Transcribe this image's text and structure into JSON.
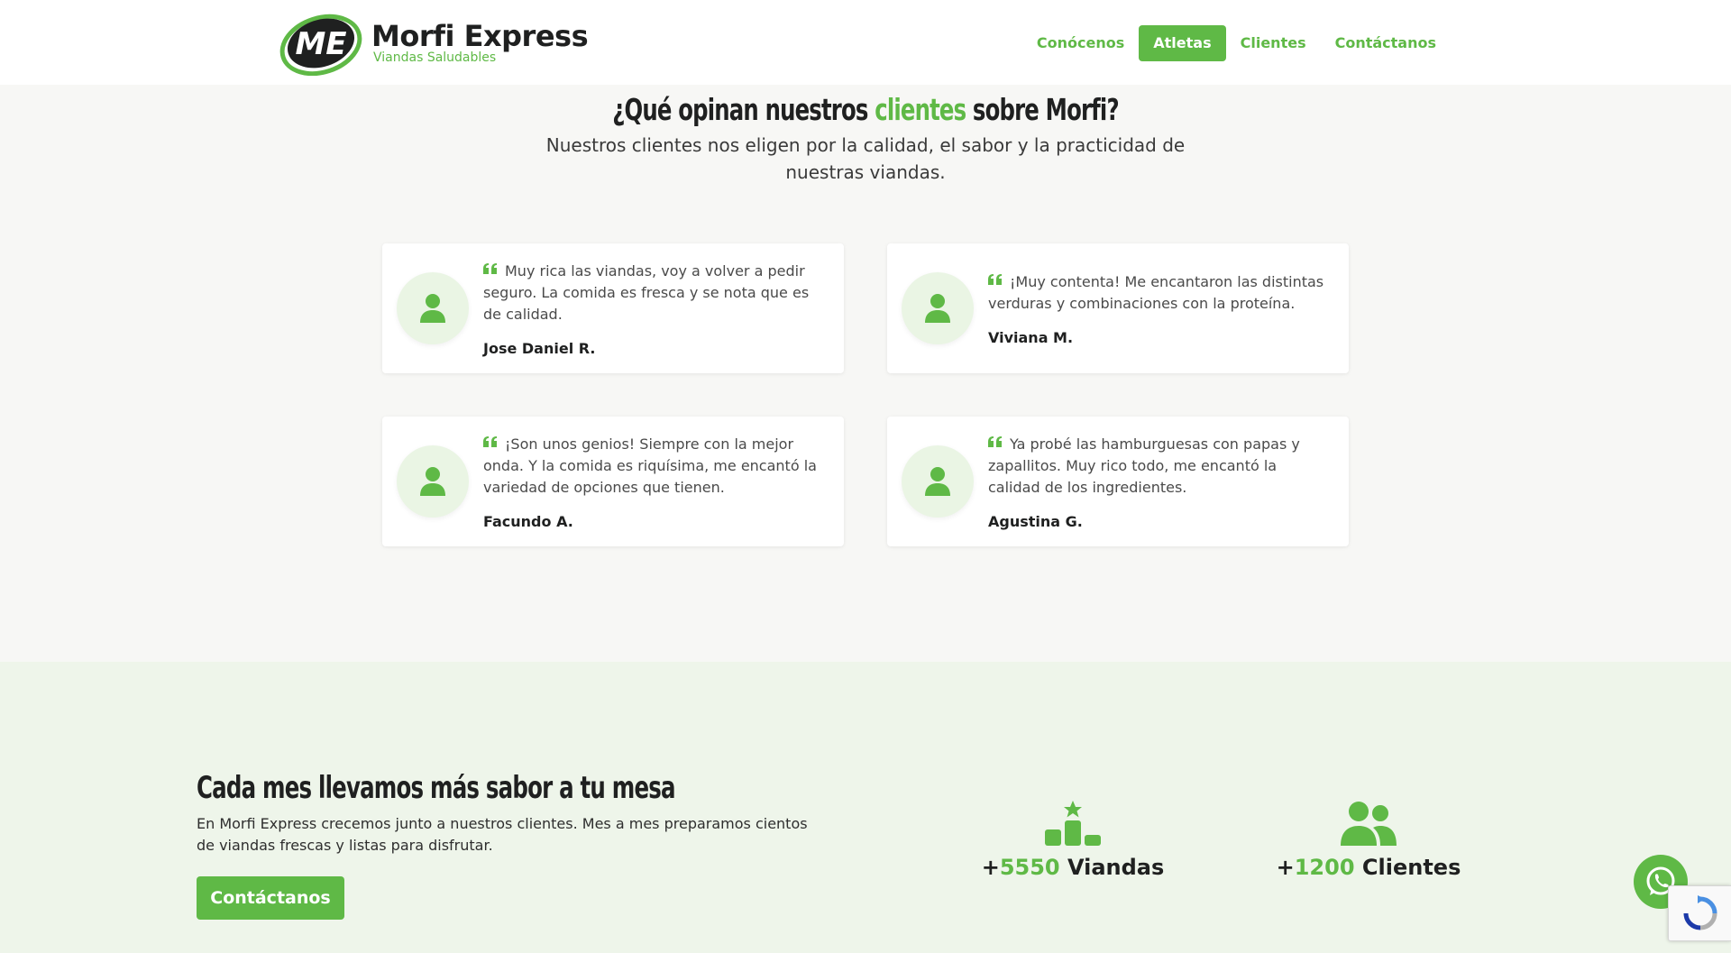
{
  "brand": {
    "name": "Morfi Express",
    "tagline": "Viandas Saludables",
    "mark": "ME"
  },
  "nav": {
    "items": [
      {
        "label": "Conócenos"
      },
      {
        "label": "Atletas"
      },
      {
        "label": "Clientes"
      },
      {
        "label": "Contáctanos"
      }
    ],
    "active": "Atletas"
  },
  "testimonials": {
    "title_before": "¿Qué opinan nuestros ",
    "title_highlight": "clientes",
    "title_after": " sobre Morfi?",
    "subtitle": "Nuestros clientes nos eligen por la calidad, el sabor y la practicidad de nuestras viandas.",
    "items": [
      {
        "quote": "Muy rica las viandas, voy a volver a pedir seguro. La comida es fresca y se nota que es de calidad.",
        "author": "Jose Daniel R."
      },
      {
        "quote": "¡Muy contenta! Me encantaron las distintas verduras y combinaciones con la proteína.",
        "author": "Viviana M."
      },
      {
        "quote": "¡Son unos genios! Siempre con la mejor onda. Y la comida es riquísima, me encantó la variedad de opciones que tienen.",
        "author": "Facundo A."
      },
      {
        "quote": "Ya probé las hamburguesas con papas y zapallitos. Muy rico todo, me encantó la calidad de los ingredientes.",
        "author": "Agustina G."
      }
    ]
  },
  "stats": {
    "title": "Cada mes llevamos más sabor a tu mesa",
    "text": "En Morfi Express crecemos junto a nuestros clientes. Mes a mes preparamos cientos de viandas frescas y listas para disfrutar.",
    "button_label": "Contáctanos",
    "items": [
      {
        "prefix": "+",
        "number": "5550",
        "label": " Viandas",
        "icon": "podium-star-icon"
      },
      {
        "prefix": "+",
        "number": "1200",
        "label": " Clientes",
        "icon": "users-icon"
      }
    ]
  },
  "colors": {
    "accent": "#5fb946",
    "dark": "#1f2020",
    "background": "#f7f7f5",
    "stats_background": "#eef5ea"
  }
}
